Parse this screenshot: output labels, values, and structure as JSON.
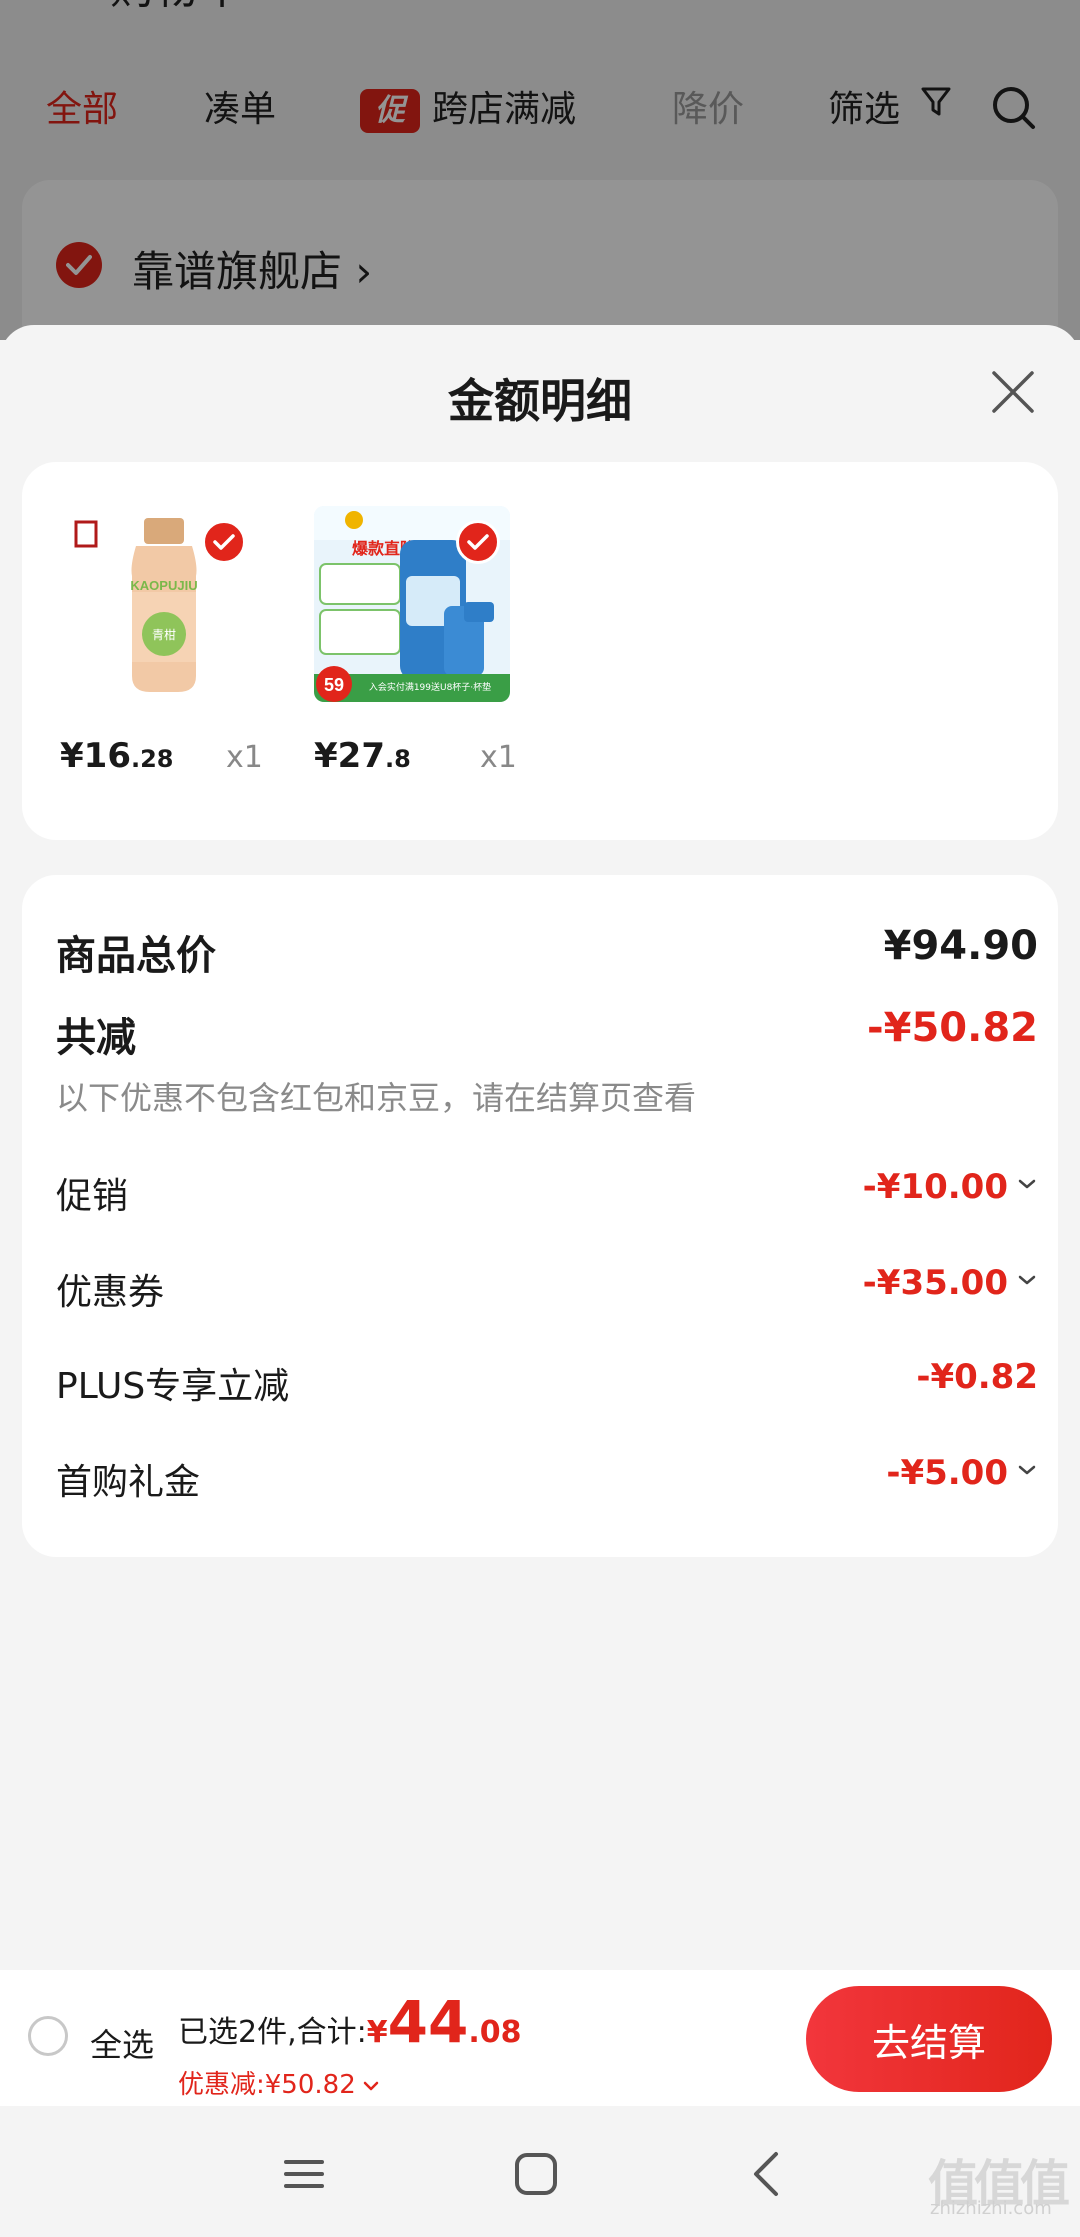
{
  "background_page": {
    "title": "购物车",
    "tabs": [
      {
        "label": "全部"
      },
      {
        "label": "凑单"
      },
      {
        "label": "跨店满减",
        "badge": "促"
      },
      {
        "label": "降价"
      },
      {
        "label": "筛选"
      }
    ],
    "store_name": "靠谱旗舰店 ›"
  },
  "sheet": {
    "title": "金额明细",
    "products": [
      {
        "price_int": "¥16",
        "price_dec": ".28",
        "qty": "x1",
        "thumb_text": "KAOPUJIU",
        "thumb_sub": "青柑"
      },
      {
        "price_int": "¥27",
        "price_dec": ".8",
        "qty": "x1",
        "thumb_text": "爆款直降",
        "thumb_sub": "59",
        "thumb_banner": "入会实付满199送U8杯子·杯垫"
      }
    ],
    "details": {
      "total_label": "商品总价",
      "total_value": "¥94.90",
      "reduce_label": "共减",
      "reduce_value": "-¥50.82",
      "note": "以下优惠不包含红包和京豆，请在结算页查看",
      "items": [
        {
          "label": "促销",
          "value": "-¥10.00"
        },
        {
          "label": "优惠券",
          "value": "-¥35.00"
        },
        {
          "label": "PLUS专享立减",
          "value": "-¥0.82"
        },
        {
          "label": "首购礼金",
          "value": "-¥5.00"
        }
      ]
    }
  },
  "bottom_bar": {
    "select_all": "全选",
    "selected_text": "已选2件,合计:",
    "currency": "¥",
    "total_int": "44",
    "total_dec": ".08",
    "discount_text": "优惠减:¥50.82",
    "checkout": "去结算"
  },
  "watermark": {
    "main": "值值值",
    "sub": "zhizhizhi.com"
  },
  "colors": {
    "accent": "#e1251b",
    "text": "#1a1a1a",
    "muted": "#8a8a8a",
    "background": "#f4f4f4"
  }
}
